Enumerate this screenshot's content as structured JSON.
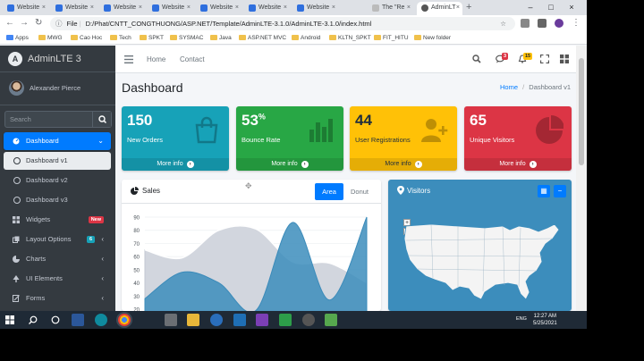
{
  "browser": {
    "tabs": [
      {
        "title": "Website"
      },
      {
        "title": "Website"
      },
      {
        "title": "Website"
      },
      {
        "title": "Website"
      },
      {
        "title": "Website"
      },
      {
        "title": "Website"
      },
      {
        "title": "Website"
      },
      {
        "title": "The \"Re"
      },
      {
        "title": "AdminLT"
      }
    ],
    "new_tab": "+",
    "address_prefix": "File",
    "address": "D:/Phat/CNTT_CONGTHUONG/ASP.NET/Template/AdminLTE-3.1.0/AdminLTE-3.1.0/index.html",
    "bookmarks": [
      "Apps",
      "MWG",
      "Cao Hoc",
      "Tech",
      "SPKT",
      "SYSMAC",
      "Java",
      "ASP.NET MVC",
      "Android",
      "KLTN_SPKT",
      "FIT_HITU",
      "New folder"
    ]
  },
  "sidebar": {
    "brand": "AdminLTE 3",
    "brand_logo": "A",
    "user": "Alexander Pierce",
    "search_placeholder": "Search",
    "items": [
      {
        "label": "Dashboard"
      },
      {
        "label": "Dashboard v1"
      },
      {
        "label": "Dashboard v2"
      },
      {
        "label": "Dashboard v3"
      },
      {
        "label": "Widgets",
        "badge": "New"
      },
      {
        "label": "Layout Options",
        "badge": "6"
      },
      {
        "label": "Charts"
      },
      {
        "label": "UI Elements"
      },
      {
        "label": "Forms"
      }
    ]
  },
  "topnav": {
    "home": "Home",
    "contact": "Contact",
    "messages_count": "3",
    "notifications_count": "15"
  },
  "header": {
    "title": "Dashboard",
    "crumb_home": "Home",
    "crumb_sep": "/",
    "crumb_current": "Dashboard v1"
  },
  "boxes": [
    {
      "value": "150",
      "suffix": "",
      "caption": "New Orders",
      "more": "More info",
      "color": "#17a2b8",
      "icon": "bag-icon"
    },
    {
      "value": "53",
      "suffix": "%",
      "caption": "Bounce Rate",
      "more": "More info",
      "color": "#28a745",
      "icon": "bar-chart-icon"
    },
    {
      "value": "44",
      "suffix": "",
      "caption": "User Registrations",
      "more": "More info",
      "color": "#ffc107",
      "icon": "user-plus-icon"
    },
    {
      "value": "65",
      "suffix": "",
      "caption": "Unique Visitors",
      "more": "More info",
      "color": "#dc3545",
      "icon": "pie-chart-icon"
    }
  ],
  "sales": {
    "title": "Sales",
    "tab_area": "Area",
    "tab_donut": "Donut",
    "y_ticks": [
      "90",
      "80",
      "70",
      "60",
      "50",
      "40",
      "30",
      "20"
    ]
  },
  "visitors": {
    "title": "Visitors",
    "zoom_in": "+",
    "zoom_out": "−"
  },
  "taskbar": {
    "lang": "ENG",
    "time": "12:27 AM",
    "date": "5/25/2021"
  },
  "chart_data": {
    "type": "area",
    "ylim": [
      20,
      90
    ],
    "series": [
      {
        "x": [
          0,
          1,
          2,
          3,
          4,
          5,
          6
        ],
        "values": [
          28,
          48,
          40,
          19,
          86,
          27,
          90
        ]
      },
      {
        "x": [
          0,
          1,
          2,
          3,
          4,
          5,
          6
        ],
        "values": [
          65,
          59,
          80,
          81,
          56,
          55,
          40
        ]
      }
    ]
  }
}
